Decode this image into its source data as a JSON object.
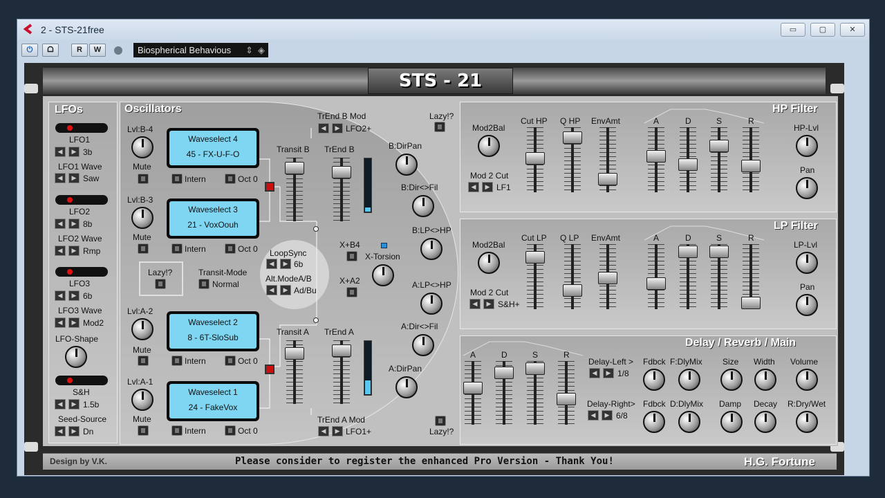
{
  "window": {
    "title": "2 - STS-21free",
    "min": "▭",
    "max": "▢",
    "close": "✕"
  },
  "toolbar": {
    "power": "⏻",
    "sep": "ᗝ",
    "read": "R",
    "write": "W",
    "preset": "Biospherical Behavious"
  },
  "logo": "STS - 21",
  "lfos": {
    "title": "LFOs",
    "items": [
      {
        "label": "LFO1",
        "value": "3b"
      },
      {
        "label": "LFO1 Wave",
        "value": "Saw"
      },
      {
        "label": "LFO2",
        "value": "8b"
      },
      {
        "label": "LFO2 Wave",
        "value": "Rmp"
      },
      {
        "label": "LFO3",
        "value": "6b"
      },
      {
        "label": "LFO3 Wave",
        "value": "Mod2"
      },
      {
        "label": "LFO-Shape"
      },
      {
        "label": "S&H",
        "value": "1.5b"
      },
      {
        "label": "Seed-Source",
        "value": "Dn"
      }
    ]
  },
  "osc": {
    "title": "Oscillators",
    "o4": {
      "lvl": "Lvl:B-4",
      "line1": "Waveselect 4",
      "line2": "45 - FX-U-F-O"
    },
    "o3": {
      "lvl": "Lvl:B-3",
      "line1": "Waveselect 3",
      "line2": "21 - VoxOouh"
    },
    "o2": {
      "lvl": "Lvl:A-2",
      "line1": "Waveselect 2",
      "line2": "8 - 6T-SloSub"
    },
    "o1": {
      "lvl": "Lvl:A-1",
      "line1": "Waveselect 1",
      "line2": "24 - FakeVox"
    },
    "mute": "Mute",
    "intern": "Intern",
    "oct": "Oct 0",
    "lazy": "Lazy!?",
    "transit_mode": "Transit-Mode",
    "normal": "Normal",
    "loopsync": "LoopSync",
    "loopsync_val": "6b",
    "altmode": "Alt.ModeA/B",
    "altmode_val": "Ad/Bu",
    "trend_b_mod": "TrEnd B Mod",
    "trend_b_mod_val": "LFO2+",
    "transit_b": "Transit B",
    "trend_b": "TrEnd B",
    "transit_a": "Transit A",
    "trend_a": "TrEnd A",
    "trend_a_mod": "TrEnd A Mod",
    "trend_a_mod_val": "LFO1+",
    "xb4": "X+B4",
    "xa2": "X+A2",
    "xtorsion": "X-Torsion",
    "bdirpan": "B:DirPan",
    "bdirfil": "B:Dir<>Fil",
    "blphp": "B:LP<>HP",
    "alphp": "A:LP<>HP",
    "adirfil": "A:Dir<>Fil",
    "adirpan": "A:DirPan",
    "lazy2": "Lazy!?",
    "lazy3": "Lazy!?"
  },
  "hp": {
    "title": "HP Filter",
    "mod2bal": "Mod2Bal",
    "mod2cut": "Mod 2 Cut",
    "mod2cut_val": "LF1",
    "cut": "Cut HP",
    "q": "Q HP",
    "env": "EnvAmt",
    "a": "A",
    "d": "D",
    "s": "S",
    "r": "R",
    "lvl": "HP-Lvl",
    "pan": "Pan"
  },
  "lp": {
    "title": "LP Filter",
    "mod2bal": "Mod2Bal",
    "mod2cut": "Mod 2 Cut",
    "mod2cut_val": "S&H+",
    "cut": "Cut LP",
    "q": "Q LP",
    "env": "EnvAmt",
    "a": "A",
    "d": "D",
    "s": "S",
    "r": "R",
    "lvl": "LP-Lvl",
    "pan": "Pan"
  },
  "dly": {
    "title": "Delay / Reverb / Main",
    "a": "A",
    "d": "D",
    "s": "S",
    "r": "R",
    "left": "Delay-Left >",
    "left_val": "1/8",
    "right": "Delay-Right>",
    "right_val": "6/8",
    "fdbck": "Fdbck",
    "fdlymix": "F:DlyMix",
    "fdbck2": "Fdbck",
    "ddlymix": "D:DlyMix",
    "size": "Size",
    "width": "Width",
    "volume": "Volume",
    "damp": "Damp",
    "decay": "Decay",
    "rdrywet": "R:Dry/Wet"
  },
  "footer": {
    "design": "Design by V.K.",
    "message": "Please consider to register the enhanced Pro Version - Thank You!",
    "brand": "H.G. Fortune"
  }
}
